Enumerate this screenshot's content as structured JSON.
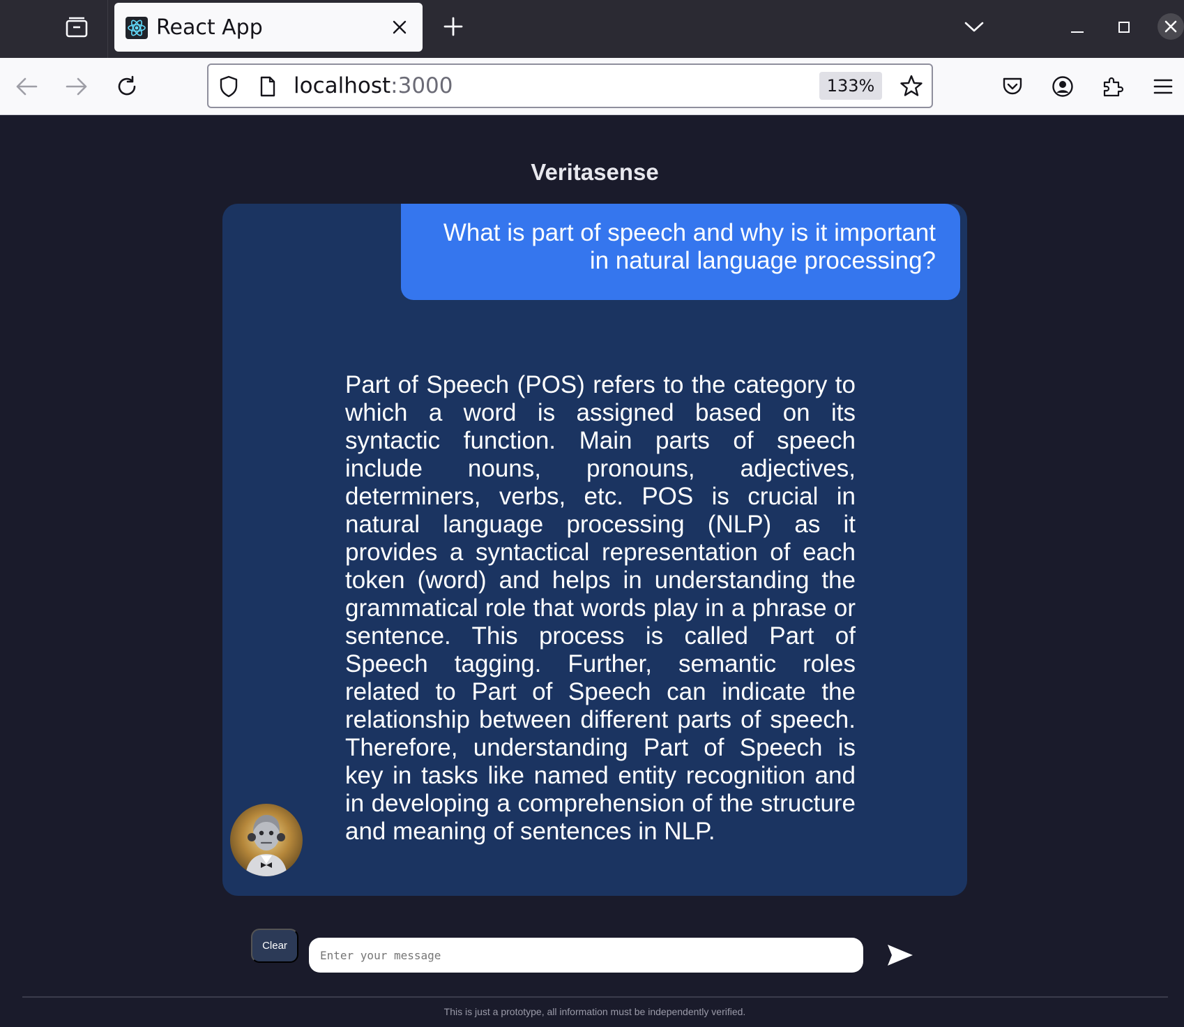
{
  "browser": {
    "tab_title": "React App",
    "url_host": "localhost",
    "url_port": ":3000",
    "zoom": "133%"
  },
  "app": {
    "title": "Veritasense",
    "user_message": "What is part of speech and why is it important in natural language processing?",
    "bot_message": "Part of Speech (POS) refers to the category to which a word is assigned based on its syntactic function. Main parts of speech include nouns, pronouns, adjectives, determiners, verbs, etc. POS is crucial in natural language processing (NLP) as it provides a syntactical representation of each token (word) and helps in understanding the grammatical role that words play in a phrase or sentence. This process is called Part of Speech tagging. Further, semantic roles related to Part of Speech can indicate the relationship between different parts of speech. Therefore, understanding Part of Speech is key in tasks like named entity recognition and in developing a comprehension of the structure and meaning of sentences in NLP.",
    "clear_label": "Clear",
    "input_placeholder": "Enter your message",
    "input_value": "",
    "footer_note": "This is just a prototype, all information must be independently verified."
  },
  "colors": {
    "page_bg": "#1a1b2b",
    "chat_panel": "#1b3461",
    "user_bubble": "#3576ee",
    "clear_button": "#2c3a57"
  },
  "icons": {
    "tab_overview": "tab-overview-icon",
    "favicon": "react-logo-icon",
    "tab_close": "close-icon",
    "new_tab": "plus-icon",
    "tab_list": "chevron-down-icon",
    "back": "arrow-left-icon",
    "forward": "arrow-right-icon",
    "reload": "reload-icon",
    "tracking": "shield-icon",
    "page_info": "page-icon",
    "bookmark": "star-icon",
    "pocket": "pocket-icon",
    "account": "account-icon",
    "extensions": "puzzle-icon",
    "menu": "hamburger-menu-icon",
    "send": "send-icon",
    "avatar": "robot-avatar"
  }
}
